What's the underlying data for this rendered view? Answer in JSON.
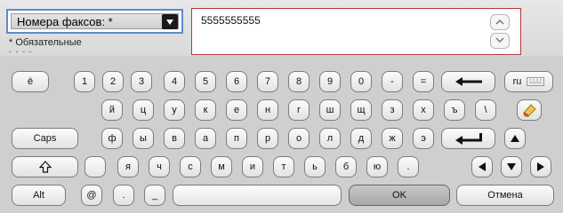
{
  "field": {
    "selector_label": "Номера факсов: *",
    "required_note": "* Обязательные",
    "required_note2": "- - - -",
    "value": "5555555555"
  },
  "keyboard": {
    "row1": [
      "ё",
      "1",
      "2",
      "3",
      "4",
      "5",
      "6",
      "7",
      "8",
      "9",
      "0",
      "-",
      "="
    ],
    "lang_label": "ru",
    "row2": [
      "й",
      "ц",
      "у",
      "к",
      "е",
      "н",
      "г",
      "ш",
      "щ",
      "з",
      "х",
      "ъ",
      "\\"
    ],
    "caps_label": "Caps",
    "row3": [
      "ф",
      "ы",
      "в",
      "а",
      "п",
      "р",
      "о",
      "л",
      "д",
      "ж",
      "э"
    ],
    "row4": [
      "я",
      "ч",
      "с",
      "м",
      "и",
      "т",
      "ь",
      "б",
      "ю",
      "."
    ],
    "alt_label": "Alt",
    "at_label": "@",
    "dot_label": ".",
    "underscore_label": "_",
    "ok_label": "OK",
    "cancel_label": "Отмена"
  }
}
